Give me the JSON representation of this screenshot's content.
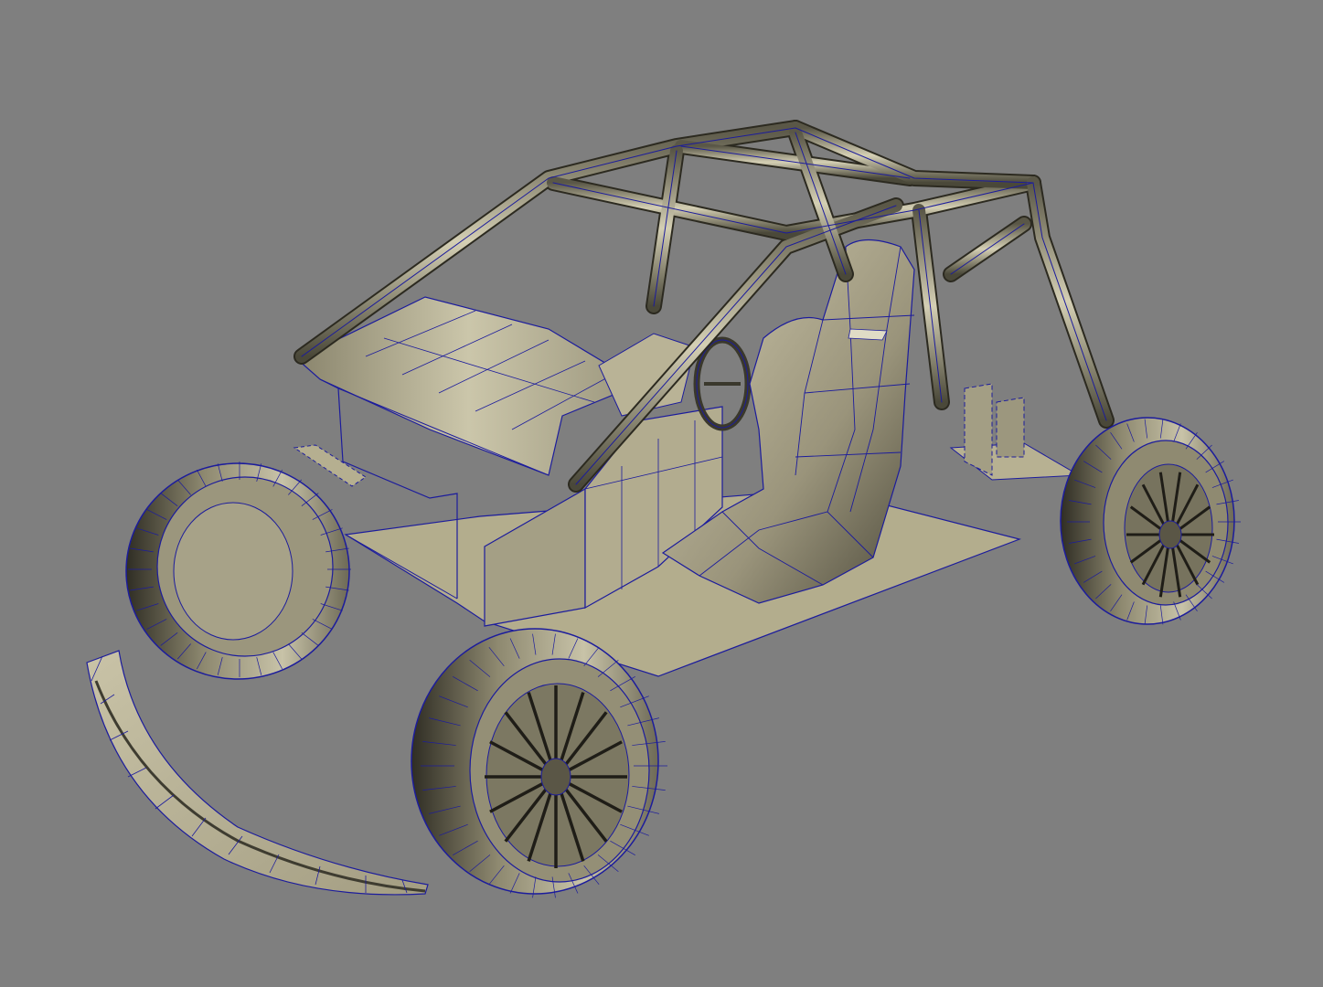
{
  "viewport": {
    "background": "#7f7f7f",
    "wire_color": "#1c1c9c",
    "shade_light": "#c4bea3",
    "shade_mid": "#8d886f",
    "shade_dark": "#3c3a2e",
    "floor_color": "#b0aa8b"
  },
  "scene": {
    "objects": [
      "roll-cage",
      "hood-panel",
      "side-pod",
      "floor-plate",
      "rear-plate",
      "seat",
      "steering-wheel",
      "front-left-tire",
      "front-right-wheel",
      "rear-right-wheel",
      "front-spoiler"
    ]
  }
}
